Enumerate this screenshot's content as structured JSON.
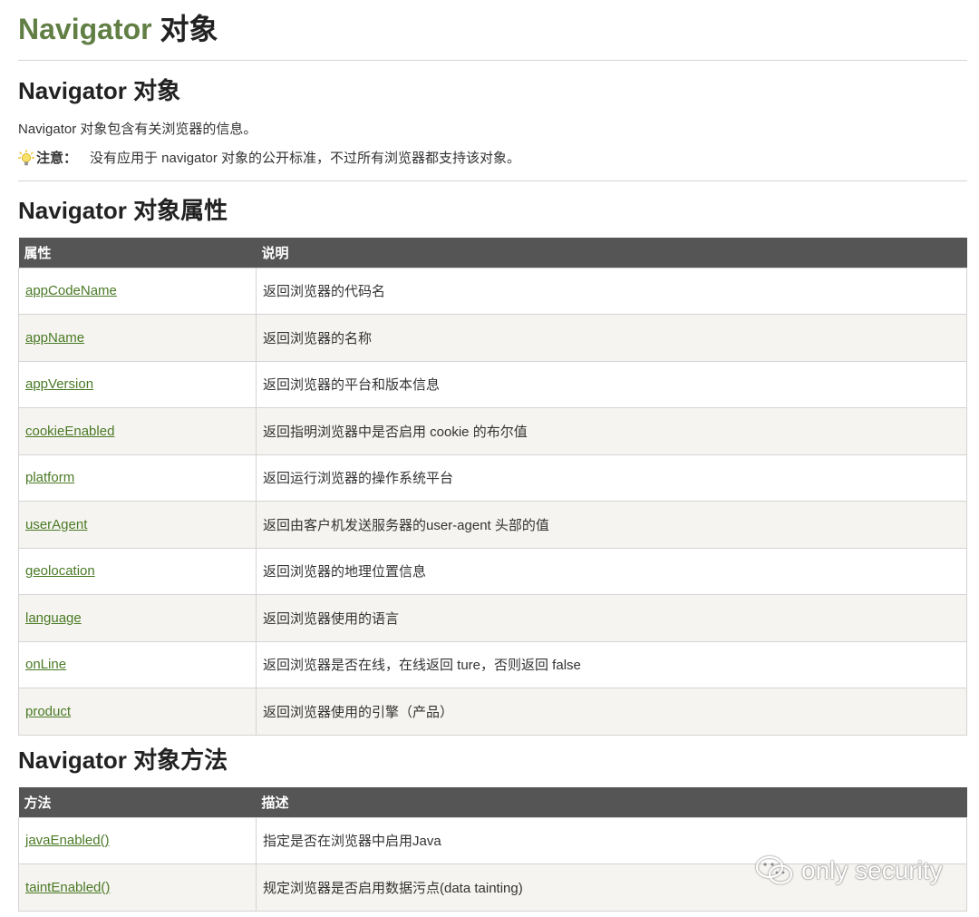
{
  "page_title": {
    "green": "Navigator",
    "dark": "对象"
  },
  "section_object": {
    "heading": "Navigator 对象",
    "intro": "Navigator 对象包含有关浏览器的信息。",
    "note_label": "注意：",
    "note_text": "没有应用于 navigator 对象的公开标准，不过所有浏览器都支持该对象。"
  },
  "section_properties": {
    "heading": "Navigator 对象属性",
    "columns": [
      "属性",
      "说明"
    ],
    "rows": [
      {
        "name": "appCodeName",
        "desc": "返回浏览器的代码名"
      },
      {
        "name": "appName",
        "desc": "返回浏览器的名称"
      },
      {
        "name": "appVersion",
        "desc": "返回浏览器的平台和版本信息"
      },
      {
        "name": "cookieEnabled",
        "desc": "返回指明浏览器中是否启用 cookie 的布尔值"
      },
      {
        "name": "platform",
        "desc": "返回运行浏览器的操作系统平台"
      },
      {
        "name": "userAgent",
        "desc": "返回由客户机发送服务器的user-agent 头部的值"
      },
      {
        "name": "geolocation",
        "desc": "返回浏览器的地理位置信息"
      },
      {
        "name": "language",
        "desc": "返回浏览器使用的语言"
      },
      {
        "name": "onLine",
        "desc": "返回浏览器是否在线，在线返回 ture，否则返回 false"
      },
      {
        "name": "product",
        "desc": "返回浏览器使用的引擎（产品）"
      }
    ]
  },
  "section_methods": {
    "heading": "Navigator 对象方法",
    "columns": [
      "方法",
      "描述"
    ],
    "rows": [
      {
        "name": "javaEnabled()",
        "desc": "指定是否在浏览器中启用Java"
      },
      {
        "name": "taintEnabled()",
        "desc": "规定浏览器是否启用数据污点(data tainting)"
      }
    ]
  },
  "watermark": {
    "text": "only security",
    "icon": "wechat-icon"
  },
  "colors": {
    "title_green": "#617f45",
    "link_green": "#4a7a26",
    "header_bg": "#555555",
    "row_alt_bg": "#f6f4f0",
    "border": "#d4d4d4"
  }
}
